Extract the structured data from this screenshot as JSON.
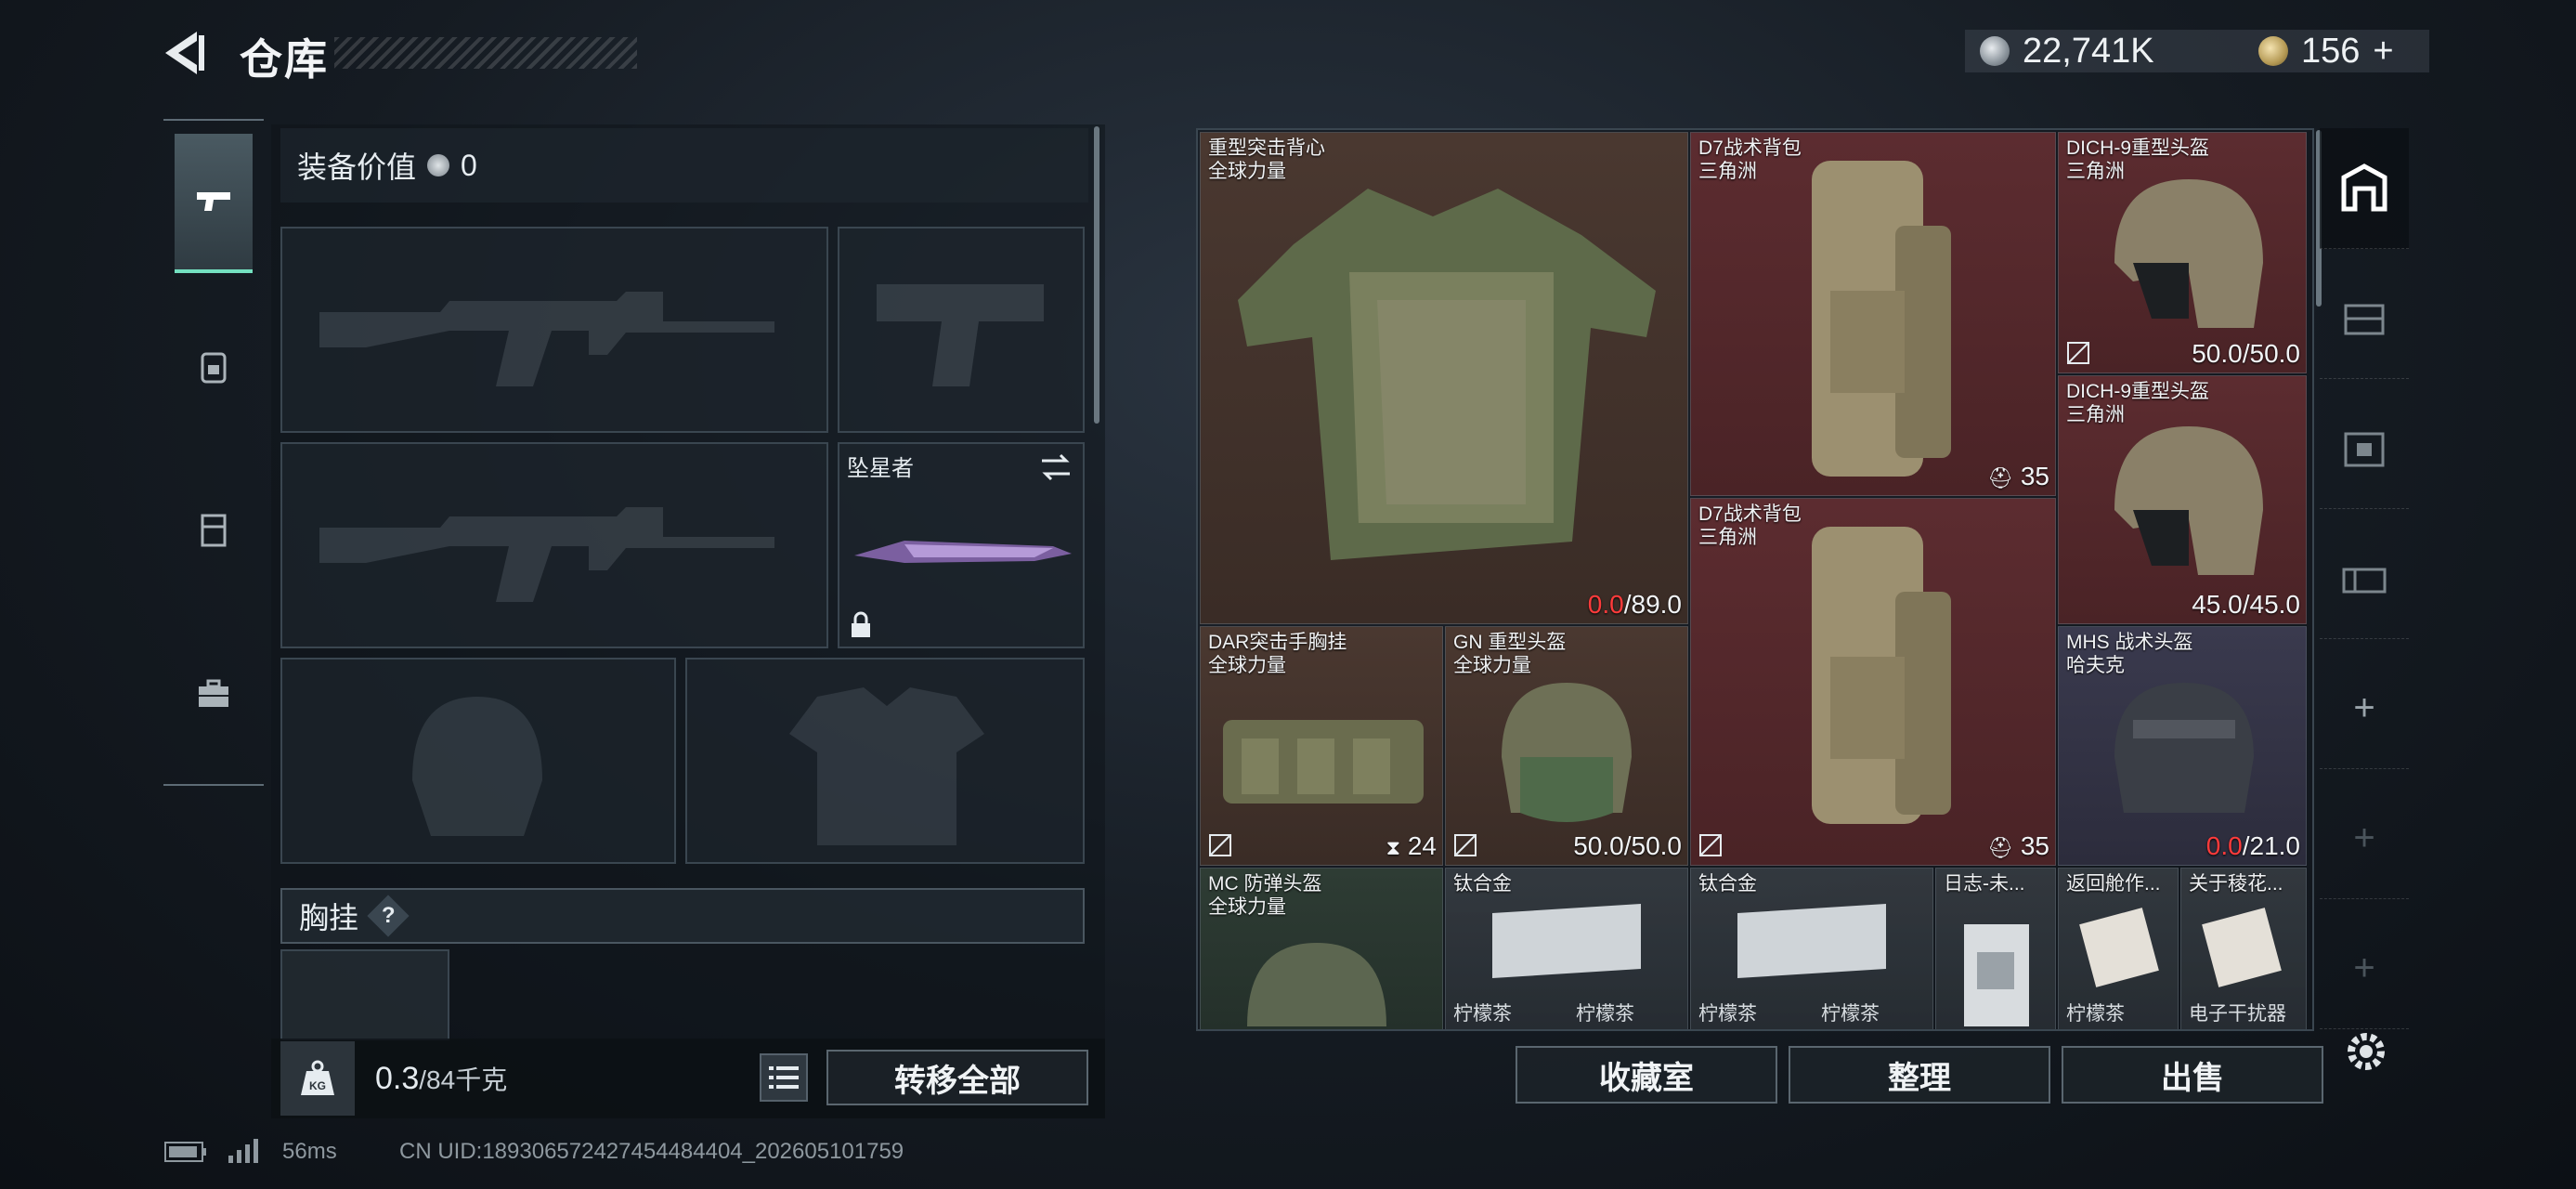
{
  "header": {
    "title": "仓库",
    "currency_silver": "22,741K",
    "currency_gold": "156",
    "currency_gold_plus": "+"
  },
  "left_rail": {
    "tabs": [
      {
        "icon": "pistol-icon",
        "active": true
      },
      {
        "icon": "backpack-icon",
        "active": false
      },
      {
        "icon": "vest-icon",
        "active": false
      },
      {
        "icon": "toolbox-icon",
        "active": false
      }
    ]
  },
  "loadout": {
    "equip_value_label": "装备价值",
    "equip_value": "0",
    "melee_slot_label": "坠星者",
    "chest_label": "胸挂",
    "help_symbol": "?",
    "weight_value": "0.3",
    "weight_max": "/84千克",
    "kg_label": "KG",
    "transfer_all": "转移全部"
  },
  "storage": {
    "items": [
      {
        "name": "重型突击背心",
        "sub": "全球力量",
        "value": "0.0",
        "max": "/89.0",
        "value_color": "#ff3b3b"
      },
      {
        "name": "D7战术背包",
        "sub": "三角洲",
        "count": "35"
      },
      {
        "name": "DICH-9重型头盔",
        "sub": "三角洲",
        "value": "50.0",
        "max": "/50.0"
      },
      {
        "name": "DICH-9重型头盔",
        "sub": "三角洲",
        "value": "45.0",
        "max": "/45.0"
      },
      {
        "name": "D7战术背包",
        "sub": "三角洲",
        "count": "35"
      },
      {
        "name": "DAR突击手胸挂",
        "sub": "全球力量",
        "count": "24"
      },
      {
        "name": "GN 重型头盔",
        "sub": "全球力量",
        "value": "50.0",
        "max": "/50.0"
      },
      {
        "name": "MHS 战术头盔",
        "sub": "哈夫克",
        "value": "0.0",
        "max": "/21.0",
        "value_color": "#ff3b3b"
      },
      {
        "name": "MC 防弹头盔",
        "sub": "全球力量"
      },
      {
        "name": "钛合金",
        "sub_a": "柠檬茶",
        "sub_b": "柠檬茶"
      },
      {
        "name": "钛合金",
        "sub_a": "柠檬茶",
        "sub_b": "柠檬茶"
      },
      {
        "name": "日志-未..."
      },
      {
        "name": "返回舱作...",
        "sub_a": "柠檬茶"
      },
      {
        "name": "关于稜花...",
        "sub_a": "电子干扰器"
      }
    ]
  },
  "bottom_buttons": {
    "collection": "收藏室",
    "sort": "整理",
    "sell": "出售"
  },
  "status": {
    "ping": "56ms",
    "uid": "CN UID:189306572427454484404_202605101759"
  },
  "colors": {
    "accent": "#74e0c0",
    "danger": "#ff3b3b"
  }
}
